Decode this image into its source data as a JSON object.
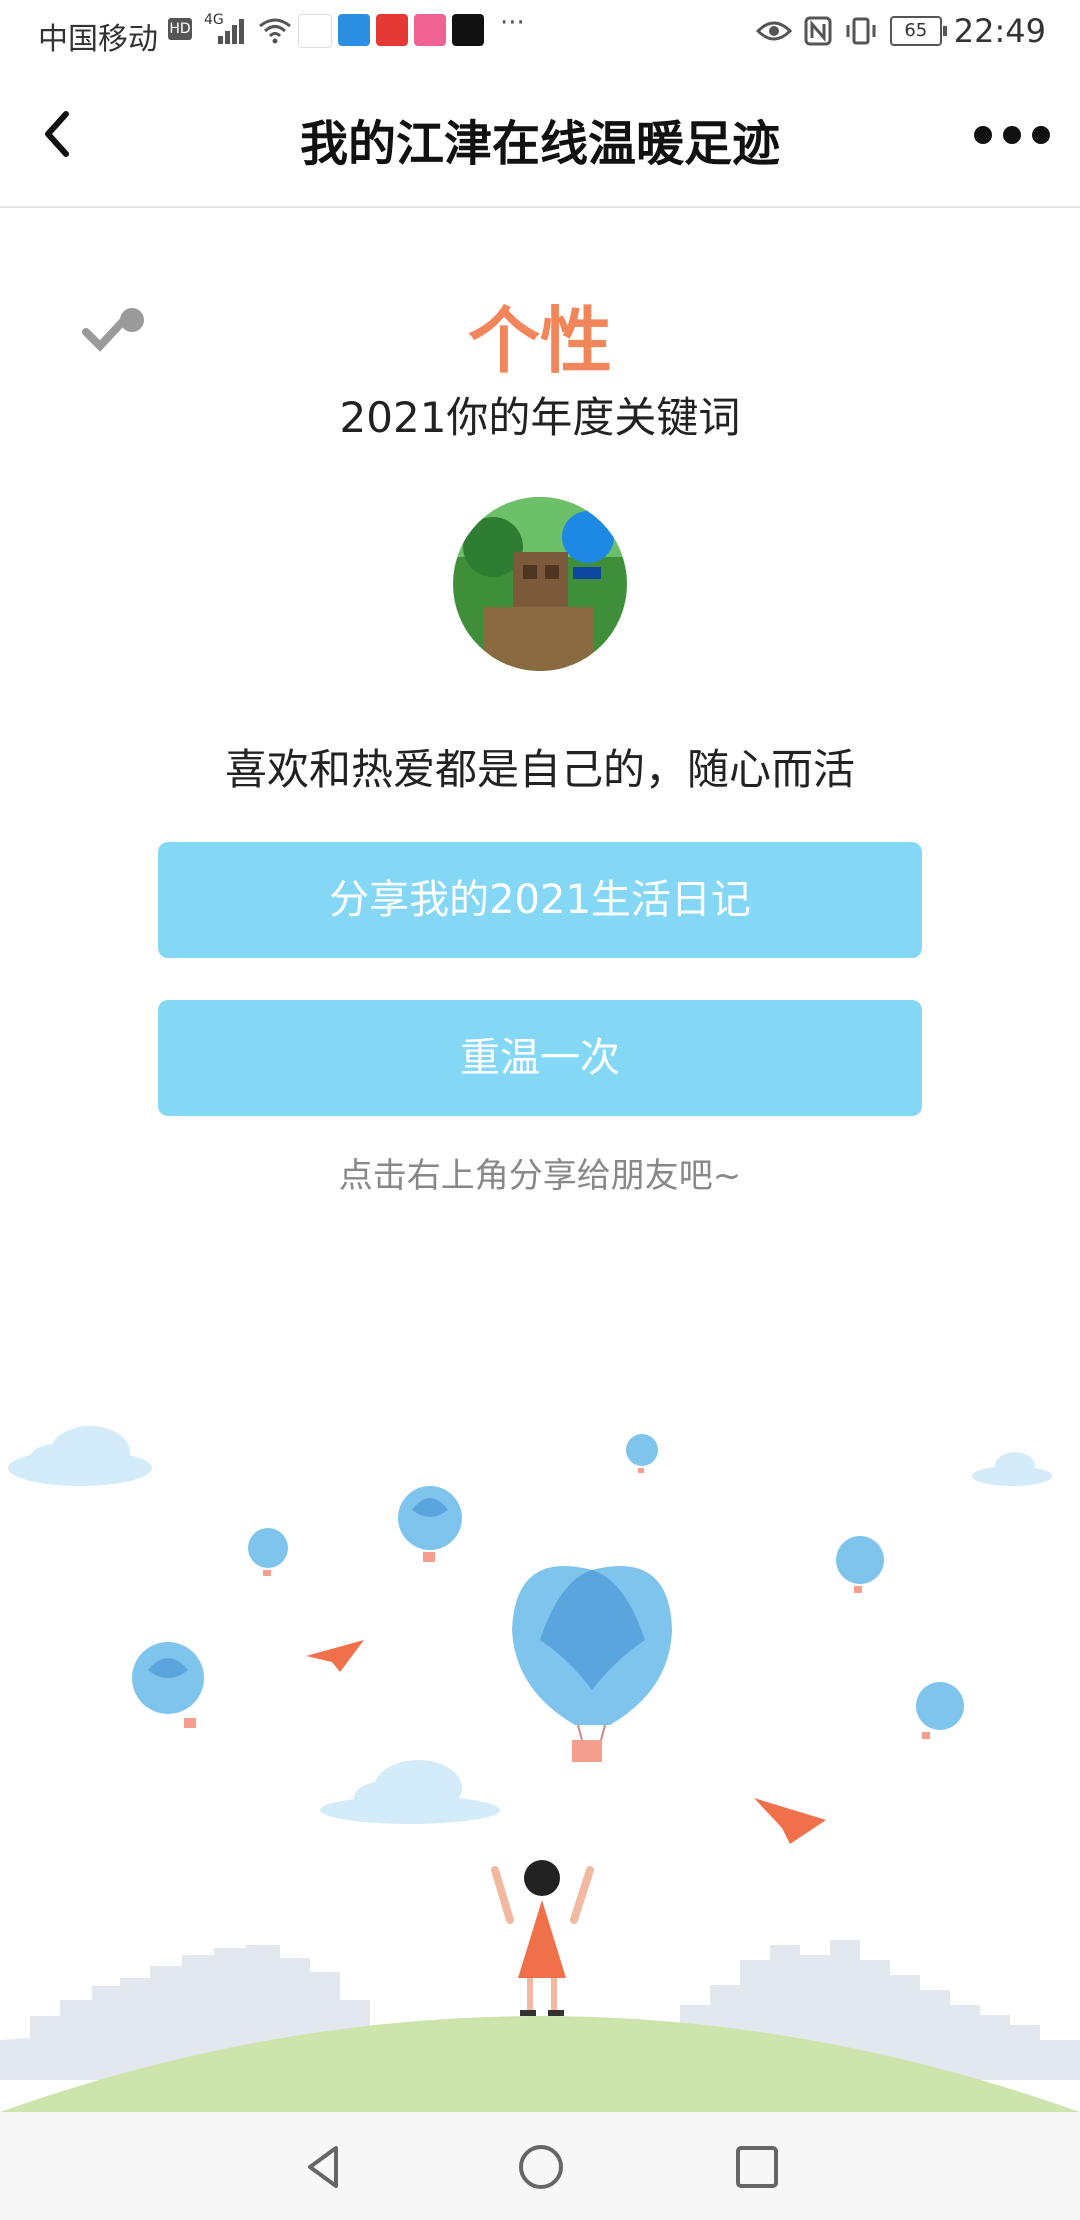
{
  "status_bar": {
    "carrier": "中国移动",
    "hd": "HD",
    "network": "4G",
    "more": "···",
    "battery": "65",
    "time": "22:49"
  },
  "header": {
    "title": "我的江津在线温暖足迹"
  },
  "content": {
    "keyword": "个性",
    "subtitle": "2021你的年度关键词",
    "motto": "喜欢和热爱都是自己的，随心而活",
    "share_button": "分享我的2021生活日记",
    "replay_button": "重温一次",
    "hint": "点击右上角分享给朋友吧~"
  },
  "colors": {
    "keyword": "#f0865a",
    "button": "#85d8f5",
    "hint": "#888888",
    "balloon": "#7fc4ec",
    "plane": "#f0704a",
    "hill": "#cde4ac"
  }
}
